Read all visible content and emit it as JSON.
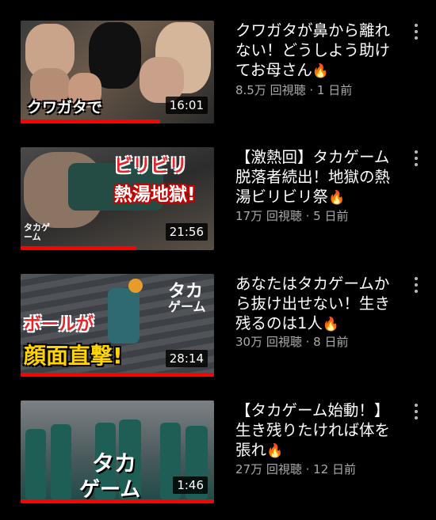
{
  "videos": [
    {
      "title": "クワガタが鼻から離れない！どうしよう助けてお母さん",
      "meta": "8.5万 回視聴 · 1 日前",
      "duration": "16:01",
      "progress": 0.72,
      "caption": "クワガタで"
    },
    {
      "title": "【激熱回】タカゲーム脱落者続出！地獄の熱湯ビリビリ祭",
      "meta": "17万 回視聴 · 5 日前",
      "duration": "21:56",
      "progress": 0.6,
      "caption1": "ビリビリ",
      "caption2": "熱湯地獄!",
      "logo": "タカゲーム"
    },
    {
      "title": "あなたはタカゲームから抜け出せない！生き残るのは1人",
      "meta": "30万 回視聴 · 8 日前",
      "duration": "28:14",
      "progress": 1.0,
      "caption1": "ボールが",
      "caption2": "顔面直撃!",
      "logo1": "タカ",
      "logo2": "ゲーム"
    },
    {
      "title": "【タカゲーム始動！】生き残りたければ体を張れ",
      "meta": "27万 回視聴 · 12 日前",
      "duration": "1:46",
      "progress": 1.0,
      "logo1": "タカ",
      "logo2": "ゲーム"
    }
  ],
  "colors": {
    "accent": "#ff0000",
    "meta": "#aaaaaa"
  }
}
